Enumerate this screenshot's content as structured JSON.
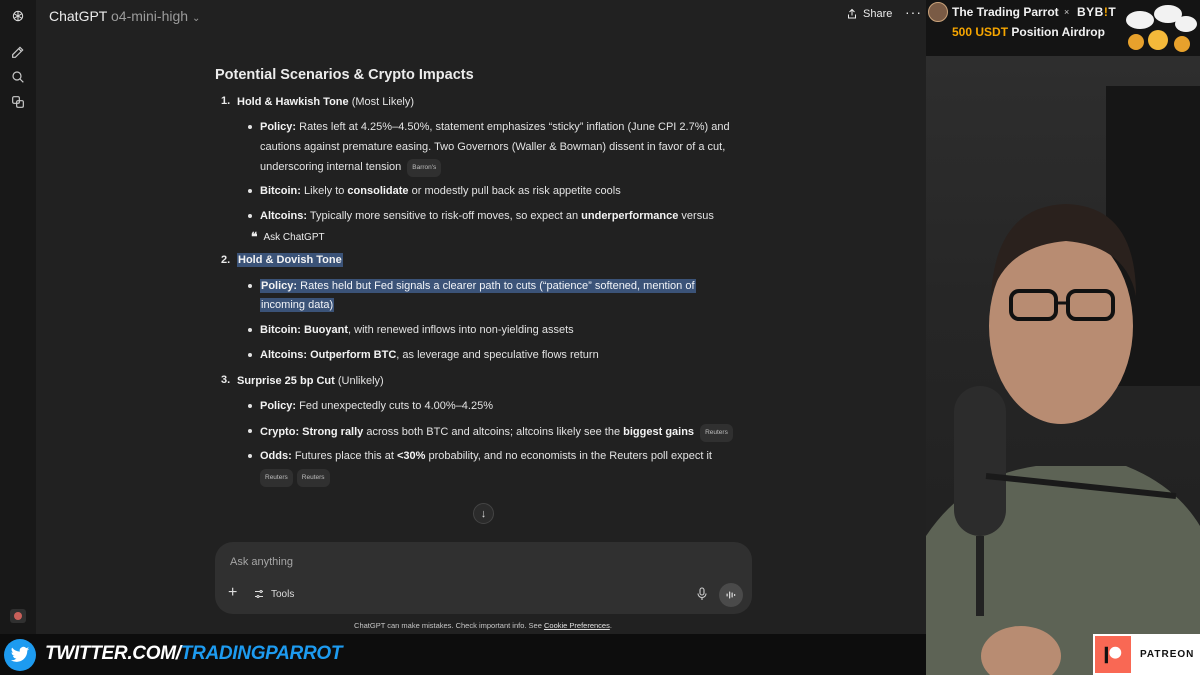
{
  "window": {
    "app_name": "ChatGPT",
    "model": "o4-mini-high",
    "share_label": "Share",
    "more_label": "···"
  },
  "response": {
    "heading": "Potential Scenarios & Crypto Impacts",
    "scenarios": [
      {
        "number": "1.",
        "title": "Hold & Hawkish Tone",
        "title_suffix": " (Most Likely)",
        "bullets": [
          {
            "label": "Policy:",
            "lines": [
              " Rates left at 4.25%–4.50%, statement emphasizes “sticky” inflation (June CPI 2.7%) and",
              "cautions against premature easing. Two Governors (Waller & Bowman) dissent in favor of a cut,",
              "underscoring internal tension"
            ],
            "sources": [
              "Barron's"
            ]
          },
          {
            "label": "Bitcoin:",
            "pre": " Likely to ",
            "bold": "consolidate",
            "post": " or modestly pull back as risk appetite cools"
          },
          {
            "label": "Altcoins:",
            "pre": " Typically more sensitive to risk-off moves, so expect an ",
            "bold": "underperformance",
            "post": " versus"
          }
        ]
      },
      {
        "number": "2.",
        "title": "Hold & Dovish Tone",
        "bullets": [
          {
            "label": "Policy:",
            "lines": [
              " Rates held but Fed signals a clearer path to cuts (“patience” softened, mention of",
              "incoming data)"
            ]
          },
          {
            "label": "Bitcoin:",
            "bold": " Buoyant",
            "post": ", with renewed inflows into non-yielding assets"
          },
          {
            "label": "Altcoins:",
            "bold": " Outperform BTC",
            "post": ", as leverage and speculative flows return"
          }
        ]
      },
      {
        "number": "3.",
        "title": "Surprise 25 bp Cut",
        "title_suffix": " (Unlikely)",
        "bullets": [
          {
            "label": "Policy:",
            "post": " Fed unexpectedly cuts to 4.00%–4.25%"
          },
          {
            "label": "Crypto:",
            "bold": " Strong rally",
            "mid": " across both BTC and altcoins; altcoins likely see the ",
            "bold2": "biggest gains",
            "sources": [
              "Reuters"
            ]
          },
          {
            "label": "Odds:",
            "pre": " Futures place this at ",
            "bold": "<30%",
            "post": " probability, and no economists in the Reuters poll expect it",
            "sources": [
              "Reuters",
              "Reuters"
            ]
          }
        ]
      }
    ],
    "ask_popup_label": "Ask ChatGPT"
  },
  "composer": {
    "placeholder": "Ask anything",
    "tools_label": "Tools"
  },
  "disclaimer": {
    "text": "ChatGPT can make mistakes. Check important info. See ",
    "link": "Cookie Preferences",
    "end": "."
  },
  "overlay": {
    "sponsor_name": "The Trading Parrot",
    "sponsor_x": "×",
    "sponsor_brand_a": "BYB",
    "sponsor_brand_b": "!",
    "sponsor_brand_c": "T",
    "promo_amount": "500 USDT",
    "promo_text": " Position Airdrop",
    "twitter_prefix": "TWITTER.COM/",
    "twitter_handle": "TRADINGPARROT",
    "patreon": "PATREON"
  },
  "colors": {
    "highlight": "#3b5378",
    "twitter_blue": "#1d9bf0",
    "bybit_orange": "#f7a600",
    "patreon_coral": "#f96854"
  },
  "icons": [
    "chatgpt-logo-icon",
    "new-chat-icon",
    "search-icon",
    "library-icon",
    "share-icon",
    "quote-icon",
    "arrow-down-icon",
    "plus-icon",
    "tools-icon",
    "microphone-icon",
    "voice-mode-icon",
    "twitter-bird-icon",
    "patreon-logo-icon"
  ]
}
